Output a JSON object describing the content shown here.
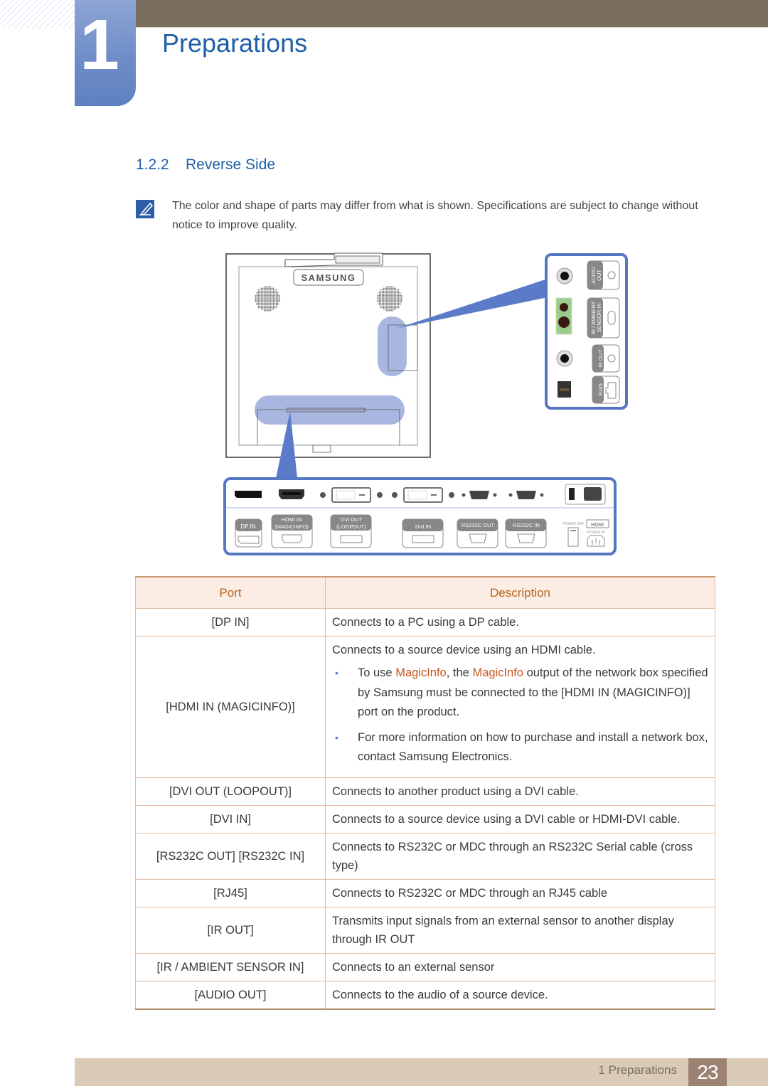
{
  "header": {
    "chapter_number": "1",
    "chapter_title": "Preparations"
  },
  "section": {
    "number": "1.2.2",
    "title": "Reverse Side"
  },
  "note": {
    "icon": "note-pencil-icon",
    "text": "The color and shape of parts may differ from what is shown. Specifications are subject to change without notice to improve quality."
  },
  "diagram": {
    "brand_logo": "SAMSUNG",
    "side_panel_labels": [
      "AUDIO OUT",
      "IR / AMBIENT SENSOR IN",
      "IR OUT",
      "RJ45"
    ],
    "bottom_panel_labels": {
      "dp_in": "DP IN",
      "hdmi_in_1": "HDMI IN",
      "hdmi_in_2": "(MAGICINFO)",
      "dvi_out_1": "DVI OUT",
      "dvi_out_2": "(LOOPOUT)",
      "dvi_in": "DVI IN",
      "rs232c_out": "RS232C OUT",
      "rs232c_in": "RS232C IN",
      "power_sw": "POWER S/W",
      "hdmi_logo": "HDMI",
      "power_in": "POWER IN"
    },
    "colors": {
      "highlight": "#a9b7e0",
      "callout_border": "#5577c2",
      "callout_beam": "#5b7bc8",
      "sensor_green": "#9ccc8c"
    }
  },
  "table": {
    "headers": [
      "Port",
      "Description"
    ],
    "rows": [
      {
        "port": "[DP IN]",
        "description": "Connects to a PC using a DP cable."
      },
      {
        "port": "[HDMI IN (MAGICINFO)]",
        "description": "Connects to a source device using an HDMI cable.",
        "bullets": [
          {
            "pre": "To use ",
            "hl1": "MagicInfo",
            "mid": ", the ",
            "hl2": "MagicInfo",
            "post": " output of the network box specified by Samsung must be connected to the [HDMI IN (MAGICINFO)] port on the product."
          },
          {
            "text": "For more information on how to purchase and install a network box, contact Samsung Electronics."
          }
        ]
      },
      {
        "port": "[DVI OUT (LOOPOUT)]",
        "description": "Connects to another product using a DVI cable."
      },
      {
        "port": "[DVI IN]",
        "description": "Connects to a source device using a DVI cable or HDMI-DVI cable."
      },
      {
        "port": "[RS232C OUT] [RS232C IN]",
        "description": "Connects to RS232C or MDC through an RS232C Serial cable (cross type)"
      },
      {
        "port": "[RJ45]",
        "description": "Connects to RS232C or MDC through an RJ45 cable"
      },
      {
        "port": "[IR OUT]",
        "description": "Transmits input signals from an external sensor to another display through IR OUT"
      },
      {
        "port": "[IR / AMBIENT SENSOR IN]",
        "description": "Connects to an external sensor"
      },
      {
        "port": "[AUDIO OUT]",
        "description": "Connects to the audio of a source device."
      }
    ]
  },
  "footer": {
    "chapter_label": "1 Preparations",
    "page_number": "23"
  }
}
